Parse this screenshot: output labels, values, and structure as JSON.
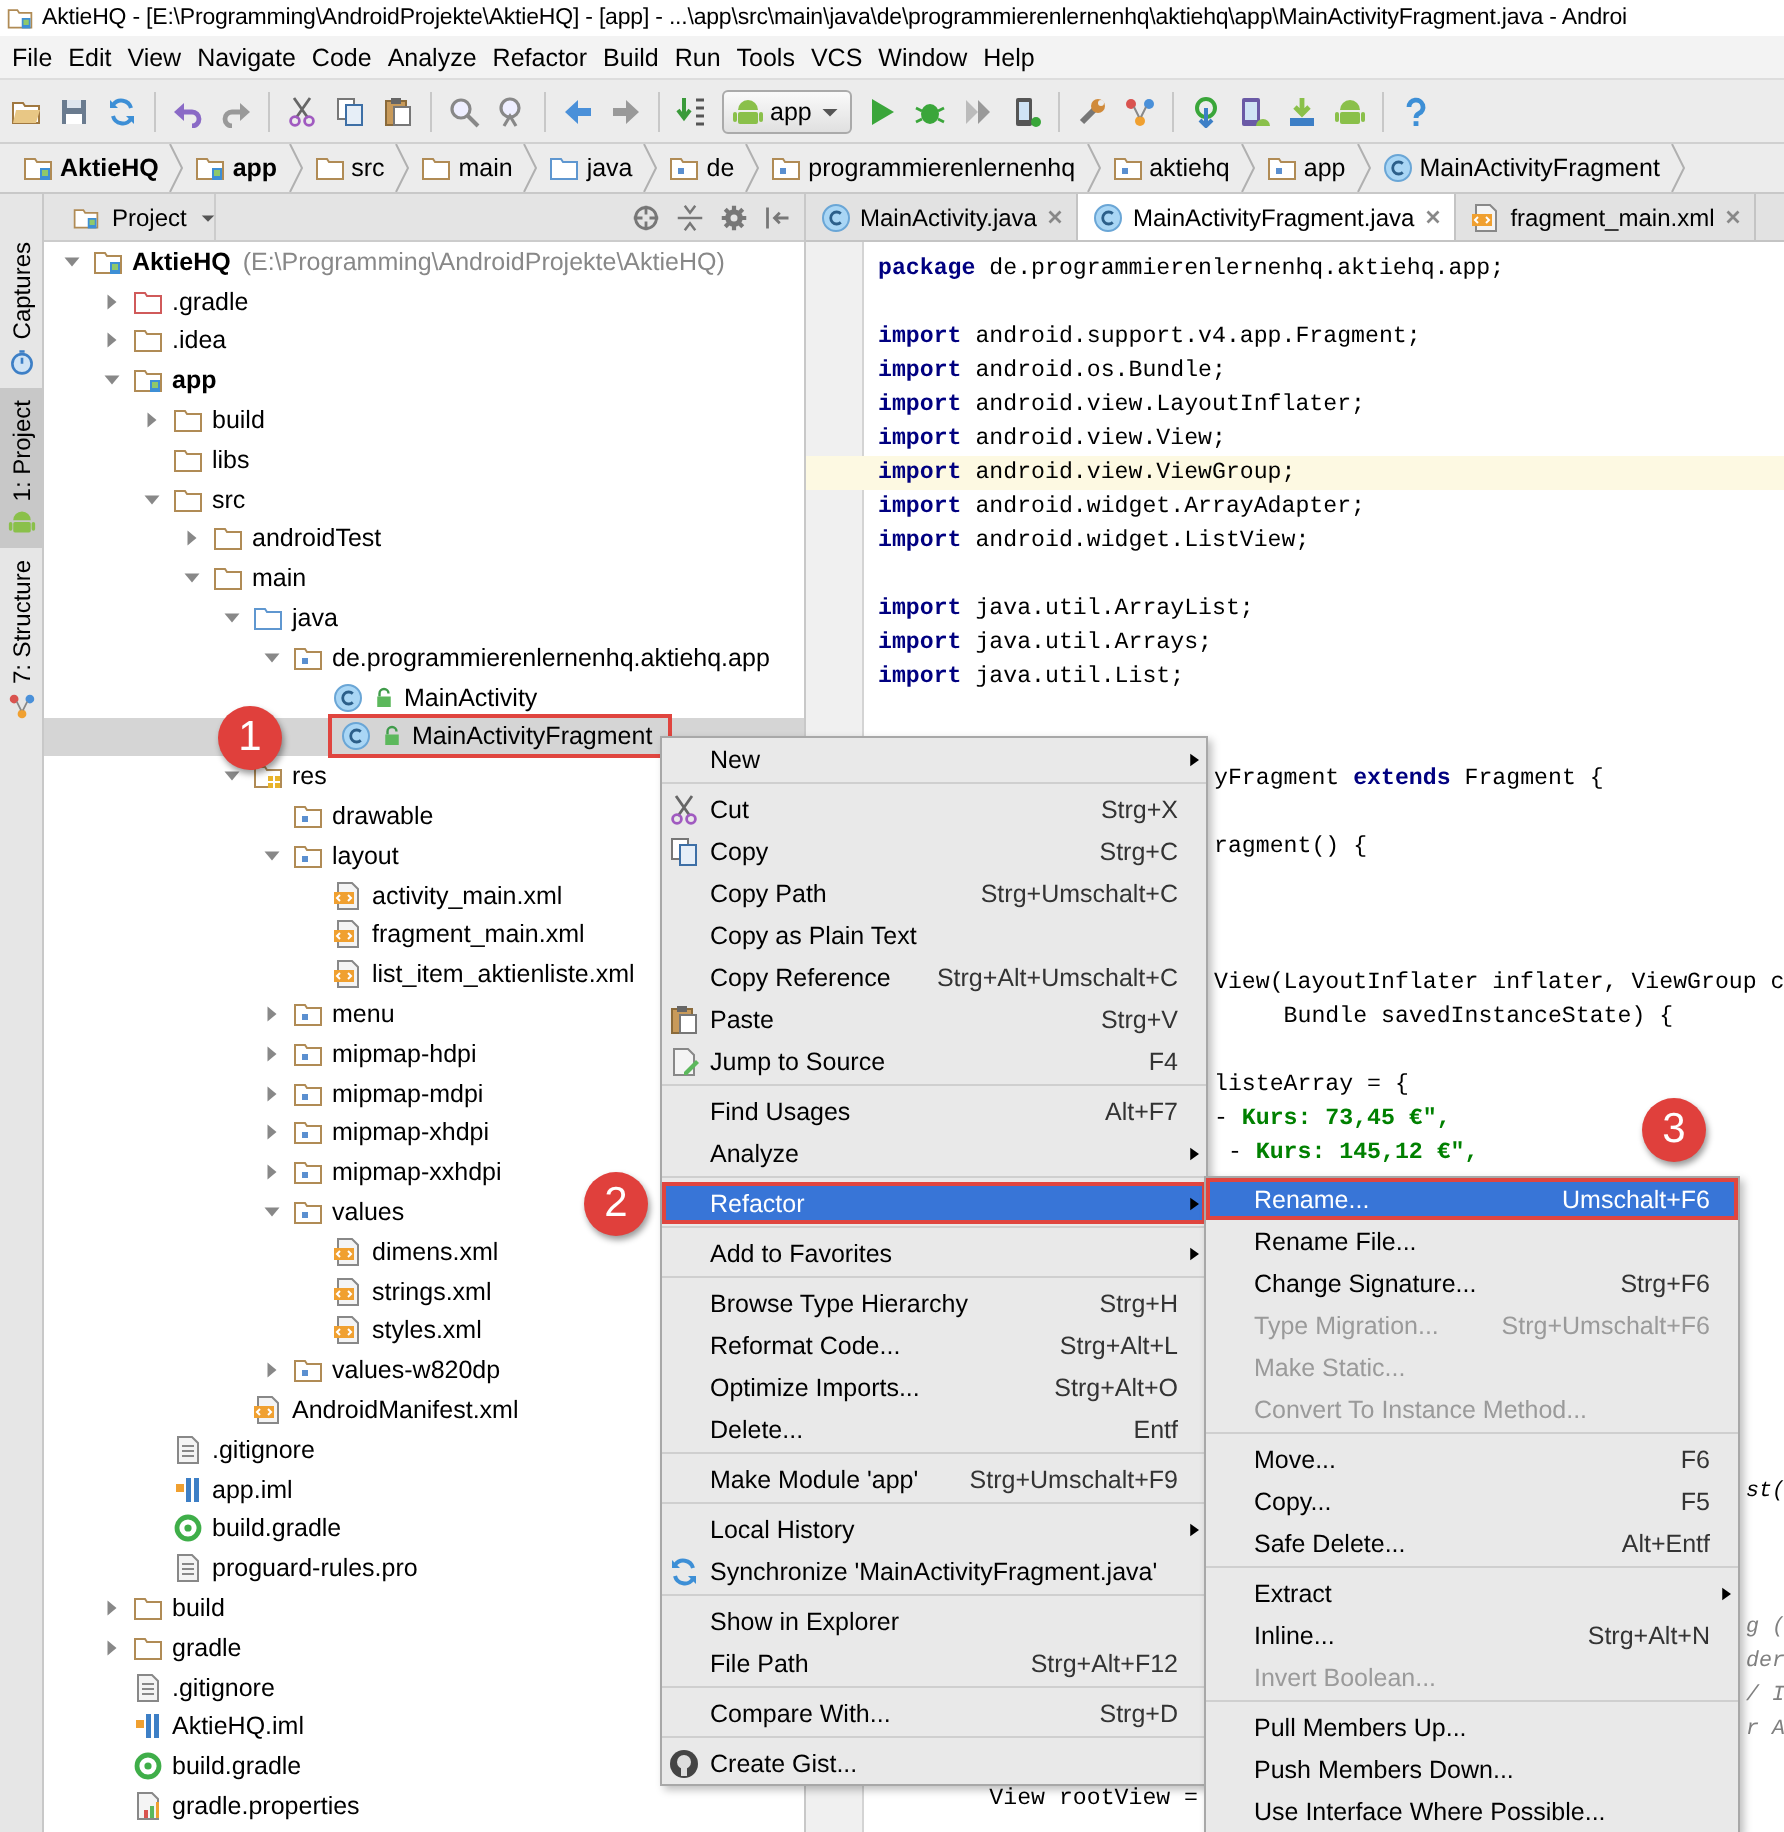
{
  "window": {
    "title": "AktieHQ - [E:\\Programming\\AndroidProjekte\\AktieHQ] - [app] - ...\\app\\src\\main\\java\\de\\programmierenlernenhq\\aktiehq\\app\\MainActivityFragment.java - Androi"
  },
  "menu_bar": [
    "File",
    "Edit",
    "View",
    "Navigate",
    "Code",
    "Analyze",
    "Refactor",
    "Build",
    "Run",
    "Tools",
    "VCS",
    "Window",
    "Help"
  ],
  "toolbar": [
    {
      "kind": "open"
    },
    {
      "kind": "save"
    },
    {
      "kind": "sync"
    },
    {
      "kind": "separator"
    },
    {
      "kind": "undo"
    },
    {
      "kind": "redo"
    },
    {
      "kind": "separator"
    },
    {
      "kind": "cut"
    },
    {
      "kind": "copy"
    },
    {
      "kind": "paste"
    },
    {
      "kind": "separator"
    },
    {
      "kind": "find"
    },
    {
      "kind": "replace"
    },
    {
      "kind": "separator"
    },
    {
      "kind": "back"
    },
    {
      "kind": "forward"
    },
    {
      "kind": "separator"
    },
    {
      "kind": "make"
    },
    {
      "kind": "combo",
      "label": "app"
    },
    {
      "kind": "run"
    },
    {
      "kind": "debug"
    },
    {
      "kind": "attach"
    },
    {
      "kind": "device"
    },
    {
      "kind": "separator"
    },
    {
      "kind": "wrench"
    },
    {
      "kind": "structure"
    },
    {
      "kind": "separator"
    },
    {
      "kind": "gradlesync"
    },
    {
      "kind": "avd"
    },
    {
      "kind": "sdk"
    },
    {
      "kind": "android"
    },
    {
      "kind": "separator"
    },
    {
      "kind": "help"
    }
  ],
  "breadcrumbs": [
    {
      "label": "AktieHQ",
      "kind": "module"
    },
    {
      "label": "app",
      "kind": "module"
    },
    {
      "label": "src",
      "kind": "folder"
    },
    {
      "label": "main",
      "kind": "folder"
    },
    {
      "label": "java",
      "kind": "source"
    },
    {
      "label": "de",
      "kind": "package"
    },
    {
      "label": "programmierenlernenhq",
      "kind": "package"
    },
    {
      "label": "aktiehq",
      "kind": "package"
    },
    {
      "label": "app",
      "kind": "package"
    },
    {
      "label": "MainActivityFragment",
      "kind": "class"
    }
  ],
  "tool_windows": [
    {
      "label": "Captures",
      "kind": "captures",
      "selected": false
    },
    {
      "label": "1: Project",
      "kind": "android",
      "selected": true
    },
    {
      "label": "7: Structure",
      "kind": "structure",
      "selected": false
    }
  ],
  "project_panel": {
    "title": "Project",
    "tree": [
      {
        "label": "AktieHQ",
        "detail": "(E:\\Programming\\AndroidProjekte\\AktieHQ)",
        "kind": "module",
        "expanded": true,
        "selected": false,
        "children": [
          {
            "label": ".gradle",
            "kind": "excluded",
            "expanded": false,
            "selected": false
          },
          {
            "label": ".idea",
            "kind": "folder",
            "expanded": false,
            "selected": false
          },
          {
            "label": "app",
            "kind": "module",
            "expanded": true,
            "selected": false,
            "children": [
              {
                "label": "build",
                "kind": "folder",
                "expanded": false,
                "selected": false
              },
              {
                "label": "libs",
                "kind": "folder",
                "selected": false
              },
              {
                "label": "src",
                "kind": "folder",
                "expanded": true,
                "selected": false,
                "children": [
                  {
                    "label": "androidTest",
                    "kind": "folder",
                    "expanded": false,
                    "selected": false
                  },
                  {
                    "label": "main",
                    "kind": "folder",
                    "expanded": true,
                    "selected": false,
                    "children": [
                      {
                        "label": "java",
                        "kind": "source",
                        "expanded": true,
                        "selected": false,
                        "children": [
                          {
                            "label": "de.programmierenlernenhq.aktiehq.app",
                            "kind": "package",
                            "expanded": true,
                            "selected": false,
                            "children": [
                              {
                                "label": "MainActivity",
                                "kind": "lockedclass",
                                "selected": false
                              },
                              {
                                "label": "MainActivityFragment",
                                "kind": "lockedclass",
                                "selected": true,
                                "annotated": true,
                                "callout": "1"
                              }
                            ]
                          }
                        ]
                      },
                      {
                        "label": "res",
                        "kind": "res",
                        "expanded": true,
                        "selected": false,
                        "children": [
                          {
                            "label": "drawable",
                            "kind": "package",
                            "selected": false
                          },
                          {
                            "label": "layout",
                            "kind": "package",
                            "expanded": true,
                            "selected": false,
                            "children": [
                              {
                                "label": "activity_main.xml",
                                "kind": "xml",
                                "selected": false
                              },
                              {
                                "label": "fragment_main.xml",
                                "kind": "xml",
                                "selected": false
                              },
                              {
                                "label": "list_item_aktienliste.xml",
                                "kind": "xml",
                                "selected": false
                              }
                            ]
                          },
                          {
                            "label": "menu",
                            "kind": "package",
                            "expanded": false,
                            "selected": false
                          },
                          {
                            "label": "mipmap-hdpi",
                            "kind": "package",
                            "expanded": false,
                            "selected": false
                          },
                          {
                            "label": "mipmap-mdpi",
                            "kind": "package",
                            "expanded": false,
                            "selected": false
                          },
                          {
                            "label": "mipmap-xhdpi",
                            "kind": "package",
                            "expanded": false,
                            "selected": false
                          },
                          {
                            "label": "mipmap-xxhdpi",
                            "kind": "package",
                            "expanded": false,
                            "selected": false
                          },
                          {
                            "label": "values",
                            "kind": "package",
                            "expanded": true,
                            "selected": false,
                            "children": [
                              {
                                "label": "dimens.xml",
                                "kind": "xml",
                                "selected": false
                              },
                              {
                                "label": "strings.xml",
                                "kind": "xml",
                                "selected": false
                              },
                              {
                                "label": "styles.xml",
                                "kind": "xml",
                                "selected": false
                              }
                            ]
                          },
                          {
                            "label": "values-w820dp",
                            "kind": "package",
                            "expanded": false,
                            "selected": false
                          }
                        ]
                      },
                      {
                        "label": "AndroidManifest.xml",
                        "kind": "xml",
                        "selected": false
                      }
                    ]
                  }
                ]
              },
              {
                "label": ".gitignore",
                "kind": "text",
                "selected": false
              },
              {
                "label": "app.iml",
                "kind": "iml",
                "selected": false
              },
              {
                "label": "build.gradle",
                "kind": "gradle",
                "selected": false
              },
              {
                "label": "proguard-rules.pro",
                "kind": "text",
                "selected": false
              }
            ]
          },
          {
            "label": "build",
            "kind": "folder",
            "expanded": false,
            "selected": false
          },
          {
            "label": "gradle",
            "kind": "folder",
            "expanded": false,
            "selected": false
          },
          {
            "label": ".gitignore",
            "kind": "text",
            "selected": false
          },
          {
            "label": "AktieHQ.iml",
            "kind": "iml",
            "selected": false
          },
          {
            "label": "build.gradle",
            "kind": "gradle",
            "selected": false
          },
          {
            "label": "gradle.properties",
            "kind": "properties",
            "selected": false
          }
        ]
      }
    ]
  },
  "editor": {
    "tabs": [
      {
        "label": "MainActivity.java",
        "kind": "class",
        "selected": false
      },
      {
        "label": "MainActivityFragment.java",
        "kind": "class",
        "selected": true
      },
      {
        "label": "fragment_main.xml",
        "kind": "xml",
        "selected": false
      }
    ],
    "lines": [
      {
        "kind": "code",
        "current": false,
        "segments": [
          {
            "kind": "keyword",
            "text": "package"
          },
          {
            "kind": "plain",
            "text": " de.programmierenlernenhq.aktiehq.app;"
          }
        ]
      },
      {
        "kind": "blank"
      },
      {
        "kind": "code",
        "current": false,
        "segments": [
          {
            "kind": "keyword",
            "text": "import"
          },
          {
            "kind": "plain",
            "text": " android.support.v4.app.Fragment;"
          }
        ]
      },
      {
        "kind": "code",
        "current": false,
        "segments": [
          {
            "kind": "keyword",
            "text": "import"
          },
          {
            "kind": "plain",
            "text": " android.os.Bundle;"
          }
        ]
      },
      {
        "kind": "code",
        "current": false,
        "segments": [
          {
            "kind": "keyword",
            "text": "import"
          },
          {
            "kind": "plain",
            "text": " android.view.LayoutInflater;"
          }
        ]
      },
      {
        "kind": "code",
        "current": false,
        "segments": [
          {
            "kind": "keyword",
            "text": "import"
          },
          {
            "kind": "plain",
            "text": " android.view.View;"
          }
        ]
      },
      {
        "kind": "code",
        "current": true,
        "segments": [
          {
            "kind": "keyword",
            "text": "import"
          },
          {
            "kind": "plain",
            "text": " android.view.ViewGroup;"
          }
        ]
      },
      {
        "kind": "code",
        "current": false,
        "segments": [
          {
            "kind": "keyword",
            "text": "import"
          },
          {
            "kind": "plain",
            "text": " android.widget.ArrayAdapter;"
          }
        ]
      },
      {
        "kind": "code",
        "current": false,
        "segments": [
          {
            "kind": "keyword",
            "text": "import"
          },
          {
            "kind": "plain",
            "text": " android.widget.ListView;"
          }
        ]
      },
      {
        "kind": "blank"
      },
      {
        "kind": "code",
        "current": false,
        "segments": [
          {
            "kind": "keyword",
            "text": "import"
          },
          {
            "kind": "plain",
            "text": " java.util.ArrayList;"
          }
        ]
      },
      {
        "kind": "code",
        "current": false,
        "segments": [
          {
            "kind": "keyword",
            "text": "import"
          },
          {
            "kind": "plain",
            "text": " java.util.Arrays;"
          }
        ]
      },
      {
        "kind": "code",
        "current": false,
        "segments": [
          {
            "kind": "keyword",
            "text": "import"
          },
          {
            "kind": "plain",
            "text": " java.util.List;"
          }
        ]
      },
      {
        "kind": "blank"
      },
      {
        "kind": "blank"
      },
      {
        "kind": "clipped",
        "current": false,
        "segments": [
          {
            "kind": "plain",
            "text": "yFragment "
          },
          {
            "kind": "keyword",
            "text": "extends"
          },
          {
            "kind": "plain",
            "text": " Fragment {"
          }
        ]
      },
      {
        "kind": "blank"
      },
      {
        "kind": "clipped",
        "current": false,
        "segments": [
          {
            "kind": "plain",
            "text": "ragment() {"
          }
        ]
      },
      {
        "kind": "blank"
      },
      {
        "kind": "blank"
      },
      {
        "kind": "blank"
      },
      {
        "kind": "clipped",
        "current": false,
        "segments": [
          {
            "kind": "plain",
            "text": "View(LayoutInflater inflater, ViewGroup c"
          }
        ]
      },
      {
        "kind": "clipped",
        "current": false,
        "segments": [
          {
            "kind": "plain",
            "text": "     Bundle savedInstanceState) {"
          }
        ]
      },
      {
        "kind": "blank"
      },
      {
        "kind": "clipped",
        "current": false,
        "segments": [
          {
            "kind": "plain",
            "text": "listeArray = {"
          }
        ]
      },
      {
        "kind": "clipped",
        "current": false,
        "segments": [
          {
            "kind": "plain",
            "text": "- "
          },
          {
            "kind": "string",
            "text": "Kurs: 73,45 €\","
          }
        ]
      },
      {
        "kind": "clipped",
        "current": false,
        "segments": [
          {
            "kind": "plain",
            "text": " - "
          },
          {
            "kind": "string",
            "text": "Kurs: 145,12 €\","
          }
        ]
      },
      {
        "kind": "blank"
      },
      {
        "kind": "blank"
      },
      {
        "kind": "blank"
      },
      {
        "kind": "blank"
      },
      {
        "kind": "blank"
      },
      {
        "kind": "blank"
      },
      {
        "kind": "blank"
      },
      {
        "kind": "blank"
      },
      {
        "kind": "blank"
      },
      {
        "kind": "edge",
        "current": false,
        "segments": [
          {
            "kind": "italic",
            "text": "st("
          }
        ]
      },
      {
        "kind": "blank"
      },
      {
        "kind": "blank"
      },
      {
        "kind": "blank"
      },
      {
        "kind": "edge",
        "current": false,
        "segments": [
          {
            "kind": "comment",
            "text": "g ("
          }
        ]
      },
      {
        "kind": "edge",
        "current": false,
        "segments": [
          {
            "kind": "comment",
            "text": "der"
          }
        ]
      },
      {
        "kind": "edge",
        "current": false,
        "segments": [
          {
            "kind": "comment",
            "text": "/ I"
          }
        ]
      },
      {
        "kind": "edge",
        "current": false,
        "segments": [
          {
            "kind": "comment",
            "text": "r A"
          }
        ]
      },
      {
        "kind": "blank"
      },
      {
        "kind": "code",
        "current": false,
        "segments": [
          {
            "kind": "plain",
            "text": "        View rootView ="
          }
        ]
      }
    ]
  },
  "context_menu": {
    "items": [
      {
        "kind": "item",
        "label": "New",
        "has_submenu": true,
        "selected": false,
        "disabled": false
      },
      {
        "kind": "separator"
      },
      {
        "kind": "cut",
        "label": "Cut",
        "shortcut": "Strg+X",
        "has_submenu": false,
        "selected": false,
        "disabled": false
      },
      {
        "kind": "copy",
        "label": "Copy",
        "shortcut": "Strg+C",
        "has_submenu": false,
        "selected": false,
        "disabled": false
      },
      {
        "kind": "item",
        "label": "Copy Path",
        "shortcut": "Strg+Umschalt+C",
        "has_submenu": false,
        "selected": false,
        "disabled": false
      },
      {
        "kind": "item",
        "label": "Copy as Plain Text",
        "has_submenu": false,
        "selected": false,
        "disabled": false
      },
      {
        "kind": "item",
        "label": "Copy Reference",
        "shortcut": "Strg+Alt+Umschalt+C",
        "has_submenu": false,
        "selected": false,
        "disabled": false
      },
      {
        "kind": "paste",
        "label": "Paste",
        "shortcut": "Strg+V",
        "has_submenu": false,
        "selected": false,
        "disabled": false
      },
      {
        "kind": "jump",
        "label": "Jump to Source",
        "shortcut": "F4",
        "has_submenu": false,
        "selected": false,
        "disabled": false
      },
      {
        "kind": "separator"
      },
      {
        "kind": "item",
        "label": "Find Usages",
        "shortcut": "Alt+F7",
        "has_submenu": false,
        "selected": false,
        "disabled": false
      },
      {
        "kind": "item",
        "label": "Analyze",
        "has_submenu": true,
        "selected": false,
        "disabled": false
      },
      {
        "kind": "separator"
      },
      {
        "kind": "item",
        "label": "Refactor",
        "has_submenu": true,
        "selected": true,
        "disabled": false,
        "annotated": true,
        "callout": "2"
      },
      {
        "kind": "separator"
      },
      {
        "kind": "item",
        "label": "Add to Favorites",
        "has_submenu": true,
        "selected": false,
        "disabled": false
      },
      {
        "kind": "separator"
      },
      {
        "kind": "item",
        "label": "Browse Type Hierarchy",
        "shortcut": "Strg+H",
        "has_submenu": false,
        "selected": false,
        "disabled": false
      },
      {
        "kind": "item",
        "label": "Reformat Code...",
        "shortcut": "Strg+Alt+L",
        "has_submenu": false,
        "selected": false,
        "disabled": false
      },
      {
        "kind": "item",
        "label": "Optimize Imports...",
        "shortcut": "Strg+Alt+O",
        "has_submenu": false,
        "selected": false,
        "disabled": false
      },
      {
        "kind": "item",
        "label": "Delete...",
        "shortcut": "Entf",
        "has_submenu": false,
        "selected": false,
        "disabled": false
      },
      {
        "kind": "separator"
      },
      {
        "kind": "item",
        "label": "Make Module 'app'",
        "shortcut": "Strg+Umschalt+F9",
        "has_submenu": false,
        "selected": false,
        "disabled": false
      },
      {
        "kind": "separator"
      },
      {
        "kind": "item",
        "label": "Local History",
        "has_submenu": true,
        "selected": false,
        "disabled": false
      },
      {
        "kind": "sync",
        "label": "Synchronize 'MainActivityFragment.java'",
        "has_submenu": false,
        "selected": false,
        "disabled": false
      },
      {
        "kind": "separator"
      },
      {
        "kind": "item",
        "label": "Show in Explorer",
        "has_submenu": false,
        "selected": false,
        "disabled": false
      },
      {
        "kind": "item",
        "label": "File Path",
        "shortcut": "Strg+Alt+F12",
        "has_submenu": false,
        "selected": false,
        "disabled": false
      },
      {
        "kind": "separator"
      },
      {
        "kind": "item",
        "label": "Compare With...",
        "shortcut": "Strg+D",
        "has_submenu": false,
        "selected": false,
        "disabled": false
      },
      {
        "kind": "separator"
      },
      {
        "kind": "gist",
        "label": "Create Gist...",
        "has_submenu": false,
        "selected": false,
        "disabled": false
      }
    ]
  },
  "refactor_submenu": {
    "items": [
      {
        "kind": "item",
        "label": "Rename...",
        "shortcut": "Umschalt+F6",
        "has_submenu": false,
        "selected": true,
        "disabled": false,
        "annotated": true,
        "callout": "3"
      },
      {
        "kind": "item",
        "label": "Rename File...",
        "has_submenu": false,
        "selected": false,
        "disabled": false
      },
      {
        "kind": "item",
        "label": "Change Signature...",
        "shortcut": "Strg+F6",
        "has_submenu": false,
        "selected": false,
        "disabled": false
      },
      {
        "kind": "item",
        "label": "Type Migration...",
        "shortcut": "Strg+Umschalt+F6",
        "has_submenu": false,
        "selected": false,
        "disabled": true
      },
      {
        "kind": "item",
        "label": "Make Static...",
        "has_submenu": false,
        "selected": false,
        "disabled": true
      },
      {
        "kind": "item",
        "label": "Convert To Instance Method...",
        "has_submenu": false,
        "selected": false,
        "disabled": true
      },
      {
        "kind": "separator"
      },
      {
        "kind": "item",
        "label": "Move...",
        "shortcut": "F6",
        "has_submenu": false,
        "selected": false,
        "disabled": false
      },
      {
        "kind": "item",
        "label": "Copy...",
        "shortcut": "F5",
        "has_submenu": false,
        "selected": false,
        "disabled": false
      },
      {
        "kind": "item",
        "label": "Safe Delete...",
        "shortcut": "Alt+Entf",
        "has_submenu": false,
        "selected": false,
        "disabled": false
      },
      {
        "kind": "separator"
      },
      {
        "kind": "item",
        "label": "Extract",
        "has_submenu": true,
        "selected": false,
        "disabled": false
      },
      {
        "kind": "item",
        "label": "Inline...",
        "shortcut": "Strg+Alt+N",
        "has_submenu": false,
        "selected": false,
        "disabled": false
      },
      {
        "kind": "item",
        "label": "Invert Boolean...",
        "has_submenu": false,
        "selected": false,
        "disabled": true
      },
      {
        "kind": "separator"
      },
      {
        "kind": "item",
        "label": "Pull Members Up...",
        "has_submenu": false,
        "selected": false,
        "disabled": false
      },
      {
        "kind": "item",
        "label": "Push Members Down...",
        "has_submenu": false,
        "selected": false,
        "disabled": false
      },
      {
        "kind": "item",
        "label": "Use Interface Where Possible...",
        "has_submenu": false,
        "selected": false,
        "disabled": false
      }
    ]
  }
}
